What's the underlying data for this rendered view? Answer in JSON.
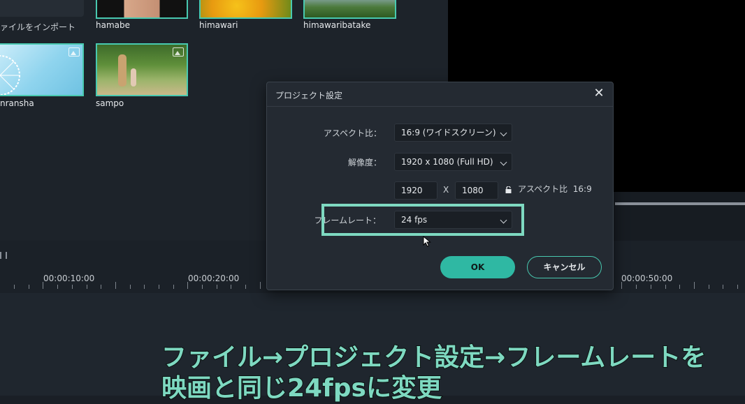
{
  "media": {
    "import_label": "ァイルをインポート",
    "clips": [
      {
        "name": "hamabe"
      },
      {
        "name": "himawari"
      },
      {
        "name": "himawaribatake"
      },
      {
        "name": "kanransha"
      },
      {
        "name": "sampo"
      }
    ],
    "clip_name_partial": "nransha"
  },
  "timeline": {
    "timecodes": [
      "00:00:10:00",
      "00:00:20:00",
      "00:00:50:00"
    ]
  },
  "dialog": {
    "title": "プロジェクト設定",
    "aspect_label": "アスペクト比：",
    "aspect_value": "16:9 (ワイドスクリーン)",
    "resolution_label": "解像度：",
    "resolution_value": "1920 x 1080 (Full HD)",
    "width_value": "1920",
    "x_sep": "X",
    "height_value": "1080",
    "aspect_note": "アスペクト比  16:9",
    "framerate_label": "フレームレート：",
    "framerate_value": "24 fps",
    "ok_label": "OK",
    "cancel_label": "キャンセル"
  },
  "caption": {
    "line1": "ファイル→プロジェクト設定→フレームレートを",
    "line2": "映画と同じ24fpsに変更"
  },
  "colors": {
    "accent": "#48c9b0",
    "highlight": "#7ed9c1",
    "dialog_bg": "#242a32"
  }
}
